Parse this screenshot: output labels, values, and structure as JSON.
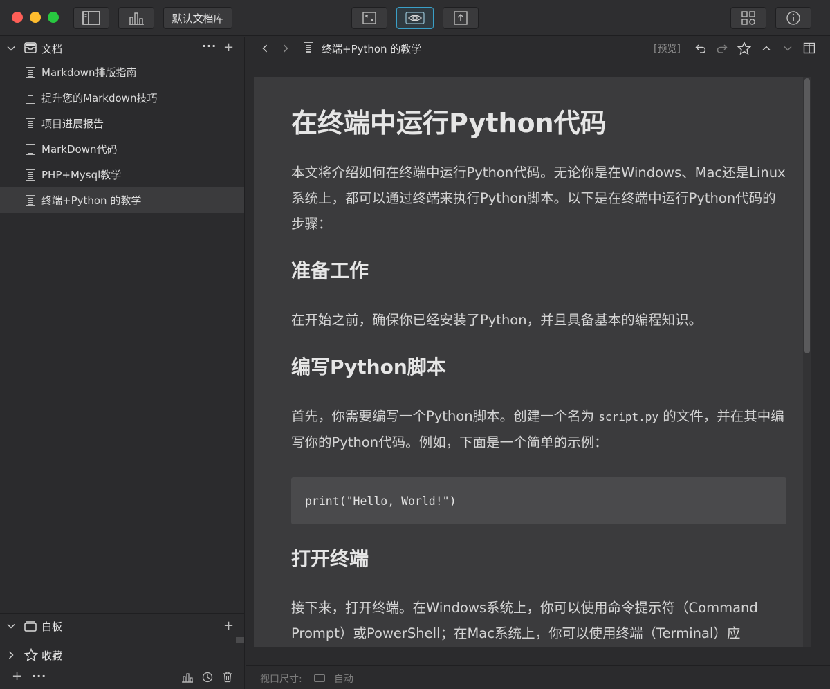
{
  "toolbar": {
    "library_label": "默认文档库",
    "icons": [
      "sidebar-toggle-icon",
      "stats-icon",
      "fullscreen-icon",
      "preview-eye-icon",
      "share-icon",
      "grid-icon",
      "info-icon"
    ]
  },
  "sidebar": {
    "documents": {
      "title": "文档",
      "items": [
        {
          "label": "Markdown排版指南"
        },
        {
          "label": "提升您的Markdown技巧"
        },
        {
          "label": "项目进展报告"
        },
        {
          "label": "MarkDown代码"
        },
        {
          "label": "PHP+Mysql教学"
        },
        {
          "label": "终端+Python 的教学",
          "selected": true
        }
      ]
    },
    "whiteboard": {
      "title": "白板"
    },
    "favorites": {
      "title": "收藏"
    }
  },
  "navbar": {
    "title": "终端+Python 的教学",
    "mode_tag": "[预览]"
  },
  "document": {
    "h1": "在终端中运行Python代码",
    "intro": "本文将介绍如何在终端中运行Python代码。无论你是在Windows、Mac还是Linux系统上，都可以通过终端来执行Python脚本。以下是在终端中运行Python代码的步骤：",
    "h2_prepare": "准备工作",
    "prepare_text": "在开始之前，确保你已经安装了Python，并且具备基本的编程知识。",
    "h2_write": "编写Python脚本",
    "write_text_before": "首先，你需要编写一个Python脚本。创建一个名为 ",
    "write_code": "script.py",
    "write_text_after": " 的文件，并在其中编写你的Python代码。例如，下面是一个简单的示例：",
    "code_block": "print(\"Hello, World!\")",
    "h2_terminal": "打开终端",
    "terminal_text": "接下来，打开终端。在Windows系统上，你可以使用命令提示符（Command Prompt）或PowerShell；在Mac系统上，你可以使用终端（Terminal）应"
  },
  "status": {
    "viewport_label": "视口尺寸:",
    "viewport_value": "自动"
  }
}
